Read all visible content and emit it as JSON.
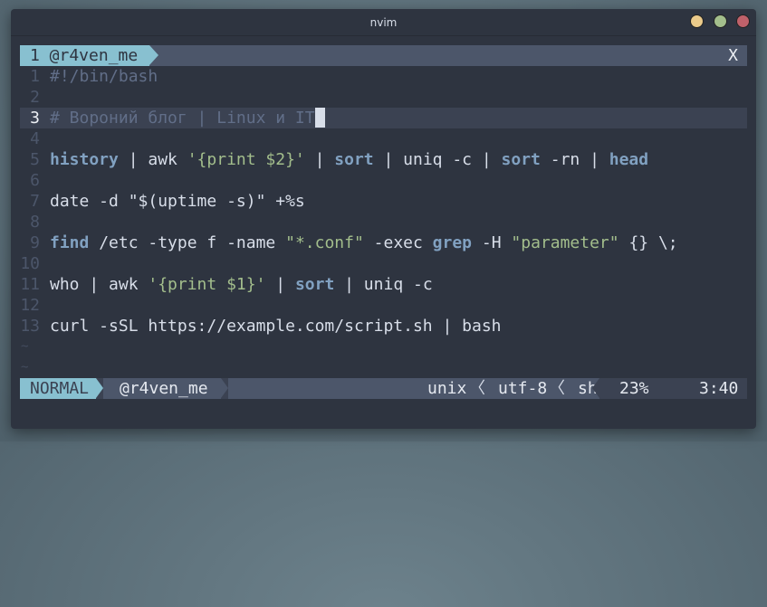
{
  "window": {
    "title": "nvim"
  },
  "tabline": {
    "tab_label": "1 @r4ven_me",
    "close_label": "X"
  },
  "lines": [
    {
      "n": "1",
      "tokens": [
        {
          "t": "#!/bin/bash",
          "c": "cm"
        }
      ]
    },
    {
      "n": "2",
      "tokens": []
    },
    {
      "n": "3",
      "current": true,
      "tokens": [
        {
          "t": "# Вороний блог | Linux и IT",
          "c": "cm"
        }
      ]
    },
    {
      "n": "4",
      "tokens": []
    },
    {
      "n": "5",
      "tokens": [
        {
          "t": "history",
          "c": "kw"
        },
        {
          "t": " | awk "
        },
        {
          "t": "'{print $2}'",
          "c": "st"
        },
        {
          "t": " | "
        },
        {
          "t": "sort",
          "c": "kw"
        },
        {
          "t": " | uniq -c | "
        },
        {
          "t": "sort",
          "c": "kw"
        },
        {
          "t": " -rn | "
        },
        {
          "t": "head",
          "c": "kw"
        }
      ]
    },
    {
      "n": "6",
      "tokens": []
    },
    {
      "n": "7",
      "tokens": [
        {
          "t": "date -d \"$(uptime -s)\" +%s"
        }
      ]
    },
    {
      "n": "8",
      "tokens": []
    },
    {
      "n": "9",
      "tokens": [
        {
          "t": "find",
          "c": "kw"
        },
        {
          "t": " /etc -type f -name "
        },
        {
          "t": "\"*.conf\"",
          "c": "st"
        },
        {
          "t": " -exec "
        },
        {
          "t": "grep",
          "c": "kw"
        },
        {
          "t": " -H "
        },
        {
          "t": "\"parameter\"",
          "c": "st"
        },
        {
          "t": " {} \\;"
        }
      ]
    },
    {
      "n": "10",
      "tokens": []
    },
    {
      "n": "11",
      "tokens": [
        {
          "t": "who | awk "
        },
        {
          "t": "'{print $1}'",
          "c": "st"
        },
        {
          "t": " | "
        },
        {
          "t": "sort",
          "c": "kw"
        },
        {
          "t": " | uniq -c"
        }
      ]
    },
    {
      "n": "12",
      "tokens": []
    },
    {
      "n": "13",
      "tokens": [
        {
          "t": "curl -sSL https://example.com/script.sh | bash"
        }
      ]
    }
  ],
  "tilde": "~",
  "statusline": {
    "mode": "NORMAL",
    "branch": "@r4ven_me",
    "fileformat": "unix",
    "encoding": "utf-8",
    "filetype": "sh",
    "percent": "23%",
    "position": "3:40",
    "sep": "〈"
  }
}
